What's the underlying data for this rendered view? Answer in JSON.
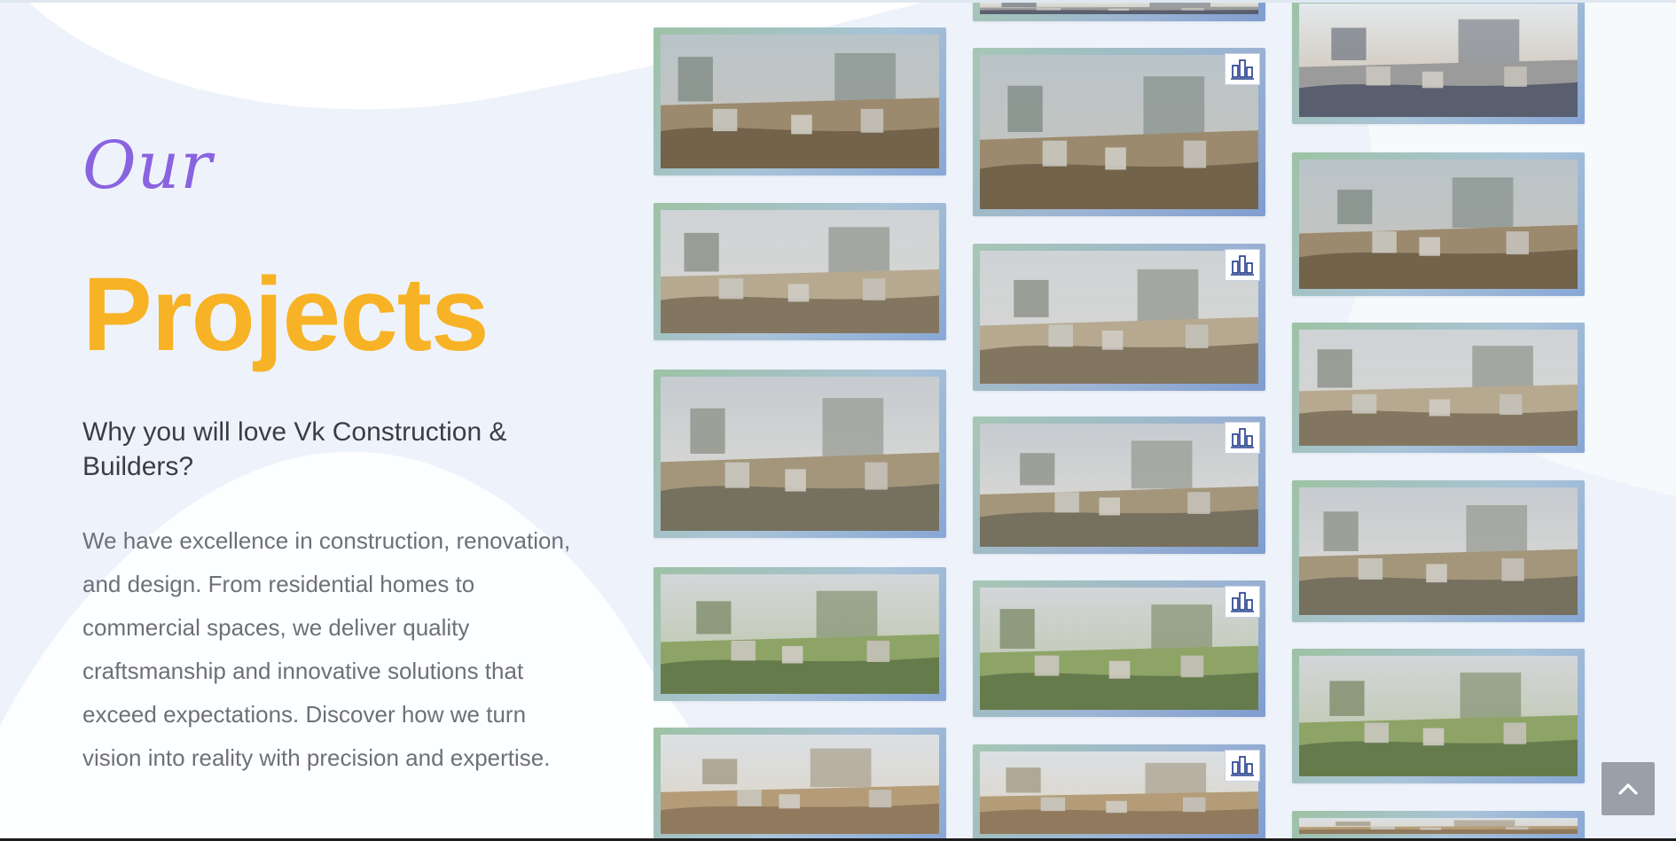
{
  "intro": {
    "script_word": "Our",
    "title": "Projects",
    "subheading": "Why you will love Vk Construction & Builders?",
    "paragraph": "We have excellence in construction, renovation, and design. From residential homes to commercial spaces, we deliver quality craftsmanship and innovative solutions that exceed expectations. Discover how we turn vision into reality with precision and expertise."
  },
  "gallery": {
    "logo_icon": "vk-construction-logo-icon",
    "columns": [
      {
        "items": [
          {
            "name": "project-photo-tank-foundation"
          },
          {
            "name": "project-photo-workers-field"
          },
          {
            "name": "project-photo-rebar-mesh"
          },
          {
            "name": "project-photo-pile-caps"
          },
          {
            "name": "project-photo-site-sheds"
          }
        ]
      },
      {
        "items": [
          {
            "name": "project-photo-top-partial"
          },
          {
            "name": "project-photo-pedestals",
            "logo": true
          },
          {
            "name": "project-photo-circular-formwork",
            "logo": true
          },
          {
            "name": "project-photo-wall-formwork",
            "logo": true
          },
          {
            "name": "project-photo-open-ground",
            "logo": true
          },
          {
            "name": "project-photo-open-ground-2",
            "logo": true
          }
        ]
      },
      {
        "items": [
          {
            "name": "project-photo-column-scaffold"
          },
          {
            "name": "project-photo-excavation"
          },
          {
            "name": "project-photo-pedestals-2"
          },
          {
            "name": "project-photo-foundation-pits"
          },
          {
            "name": "project-photo-slab-underside"
          },
          {
            "name": "project-photo-bottom-partial"
          }
        ]
      }
    ]
  },
  "back_to_top": {
    "icon": "chevron-up-icon"
  },
  "colors": {
    "accent_script": "#8a63e0",
    "accent_title": "#f7b325",
    "card_border_start": "#9dc2a4",
    "card_border_end": "#88a7d6",
    "page_bg": "#eef3fb"
  }
}
